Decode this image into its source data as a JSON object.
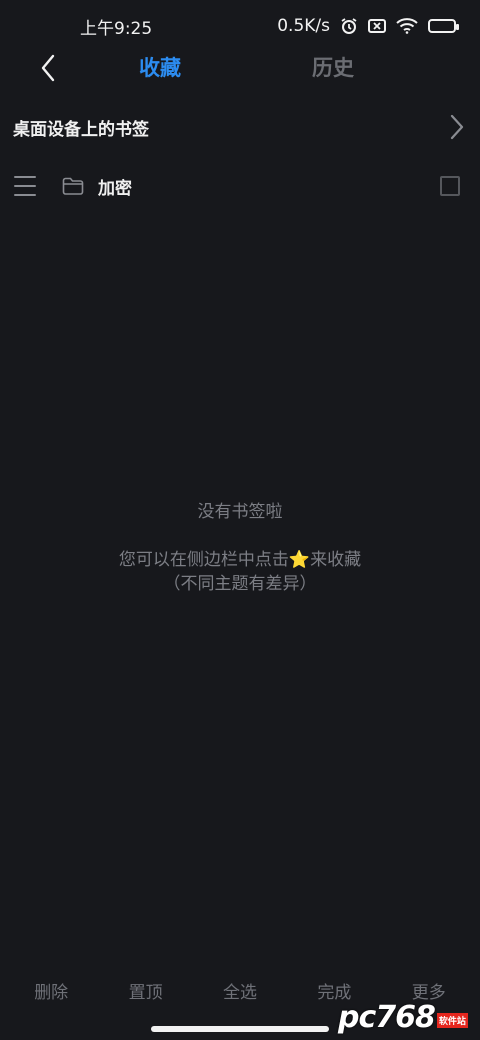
{
  "status_bar": {
    "time": "上午9:25",
    "network_speed": "0.5K/s",
    "icons": [
      "alarm-icon",
      "sim-off-icon",
      "wifi-icon",
      "battery-icon"
    ],
    "battery_level": 0.9
  },
  "header": {
    "back_icon": "chevron-left-icon",
    "tabs": [
      {
        "label": "收藏",
        "active": true
      },
      {
        "label": "历史",
        "active": false
      }
    ]
  },
  "desktop_bookmarks": {
    "label": "桌面设备上的书签",
    "icon": "chevron-right-icon"
  },
  "folders": [
    {
      "label": "加密",
      "icon": "folder-icon",
      "checked": false
    }
  ],
  "empty_state": {
    "title": "没有书签啦",
    "hint_before": "您可以在侧边栏中点击",
    "hint_star": "⭐",
    "hint_after": "来收藏",
    "note": "（不同主题有差异）"
  },
  "bottom_actions": {
    "delete": "删除",
    "pin": "置顶",
    "select_all": "全选",
    "done": "完成",
    "more": "更多"
  },
  "watermark": {
    "text": "pc768",
    "sub": "软件站"
  },
  "colors": {
    "background": "#17181c",
    "accent": "#2c8cf0",
    "inactive": "#6b6d73",
    "star": "#f5c518"
  }
}
